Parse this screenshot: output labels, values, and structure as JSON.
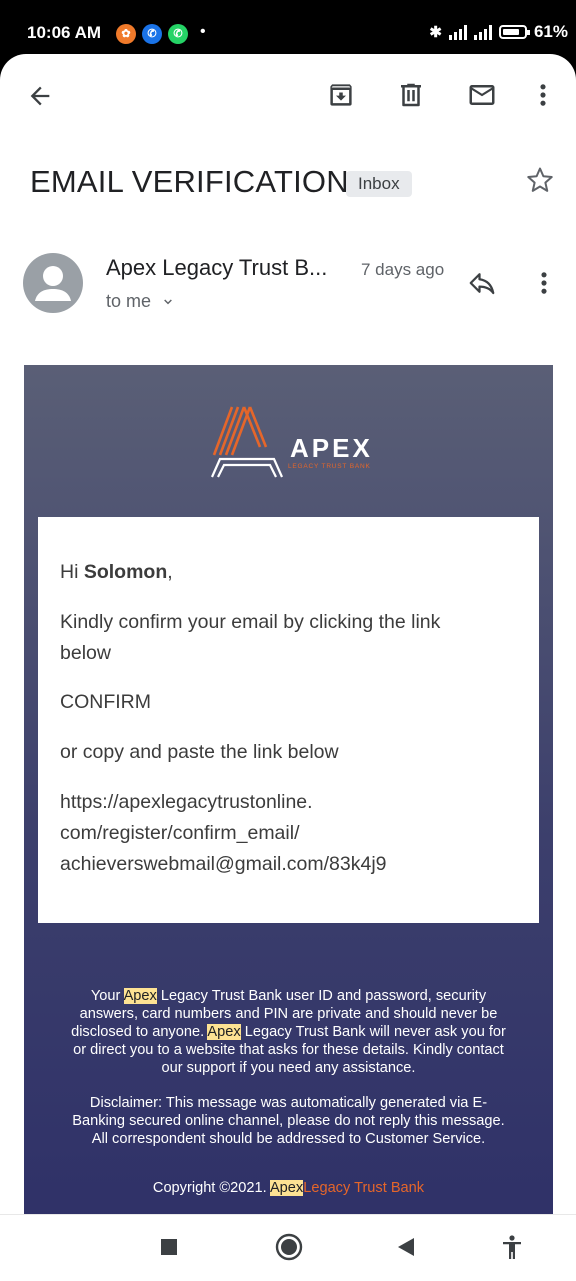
{
  "status": {
    "time": "10:06 AM",
    "dot": "•",
    "battery": "61%"
  },
  "icons": {
    "back": "arrow-left-icon",
    "archive": "archive-icon",
    "delete": "trash-icon",
    "unread": "mail-icon",
    "more": "more-vert-icon",
    "star": "star-outline-icon",
    "reply": "reply-icon",
    "expand": "chevron-down-icon"
  },
  "email": {
    "subject": "EMAIL VERIFICATION",
    "label": "Inbox",
    "sender": "Apex Legacy Trust B...",
    "date": "7 days ago",
    "recipient": "to me"
  },
  "body": {
    "logo_name": "APEX",
    "logo_tagline": "LEGACY TRUST BANK",
    "greeting_prefix": "Hi",
    "greeting_name": "Solomon",
    "greeting_suffix": ",",
    "instruction": "Kindly confirm your email by clicking the link below",
    "confirm_link": "CONFIRM",
    "copy_text": "or copy and paste the link below",
    "url_line1": "https://apexlegacytrustonline.",
    "url_line2": "com/register/confirm_email/",
    "url_line3": "achieverswebmail@gmail.com/83k4j9"
  },
  "footer": {
    "p1_a": "Your",
    "p1_hl1": "Apex",
    "p1_b": "Legacy Trust Bank user ID and password, security answers, card numbers and PIN are private and should never be disclosed to anyone.",
    "p1_hl2": "Apex",
    "p1_c": "Legacy Trust Bank will never ask you for or direct you to a website that asks for these details. Kindly contact our support if you need any assistance.",
    "disclaimer": "Disclaimer: This message was automatically generated via E-Banking secured online channel, please do not reply this message. All correspondent should be addressed to Customer Service.",
    "copyright": "Copyright ©2021.",
    "copyright_hl": "Apex",
    "copyright_brand": "Legacy Trust Bank"
  },
  "colors": {
    "accent_orange": "#e5662a",
    "link_blue": "#3b82c4",
    "email_bg_top": "#5a5f76",
    "email_bg_bottom": "#2f3168",
    "highlight": "#fde293"
  },
  "navbar": {
    "recents": "square-icon",
    "home": "circle-icon",
    "back": "triangle-back-icon",
    "accessibility": "accessibility-icon"
  }
}
